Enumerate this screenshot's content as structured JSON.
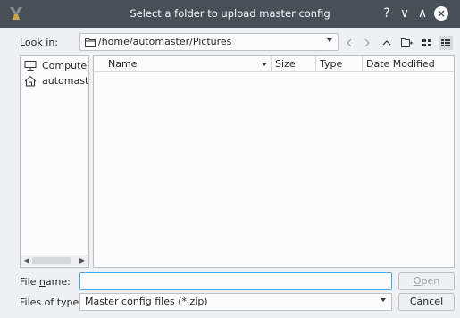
{
  "window": {
    "title": "Select a folder to upload master config",
    "controls": {
      "help": "?",
      "minimize": "∨",
      "maximize": "∧",
      "close": "×"
    }
  },
  "toolbar": {
    "look_in_label": "Look in:",
    "path": "/home/automaster/Pictures",
    "icons": [
      "back-icon",
      "forward-icon",
      "up-icon",
      "new-folder-icon",
      "list-view-icon",
      "detail-view-icon"
    ]
  },
  "sidebar": {
    "items": [
      {
        "label": "Computer",
        "icon": "computer-icon"
      },
      {
        "label": "automast",
        "icon": "home-icon"
      }
    ]
  },
  "file_list": {
    "columns": [
      "Name",
      "Size",
      "Type",
      "Date Modified"
    ],
    "rows": []
  },
  "footer": {
    "file_name_label_pre": "File ",
    "file_name_label_ul": "n",
    "file_name_label_post": "ame:",
    "file_name_value": "",
    "files_of_type_label": "Files of type:",
    "files_of_type_value": "Master config files (*.zip)",
    "open_button_ul": "O",
    "open_button_rest": "pen",
    "cancel_button": "Cancel"
  },
  "colors": {
    "titlebar": "#475057",
    "window_bg": "#eff0f1",
    "focus": "#3daee9"
  }
}
